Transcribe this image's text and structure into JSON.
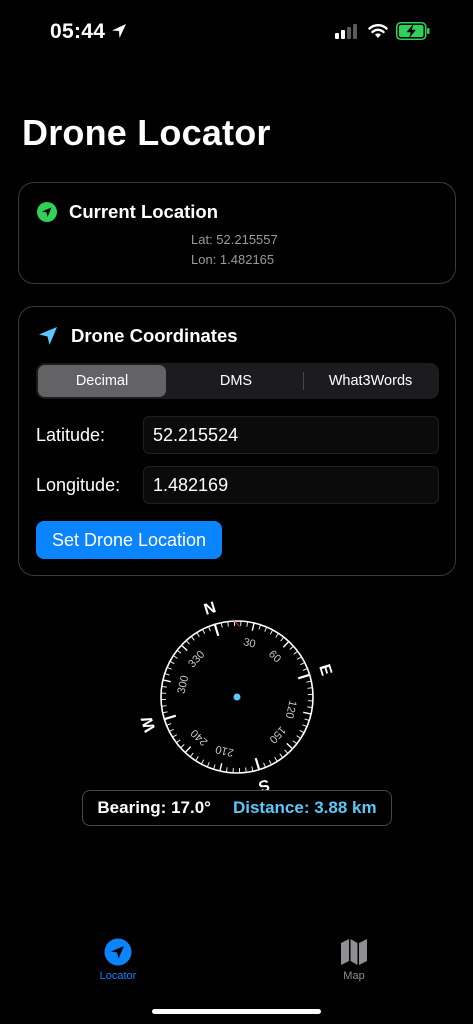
{
  "status_bar": {
    "time": "05:44",
    "battery_state": "charging"
  },
  "page_title": "Drone Locator",
  "current_location": {
    "title": "Current Location",
    "lat_line": "Lat: 52.215557",
    "lon_line": "Lon: 1.482165"
  },
  "drone_coordinates": {
    "title": "Drone Coordinates",
    "segments": [
      "Decimal",
      "DMS",
      "What3Words"
    ],
    "selected_segment": "Decimal",
    "latitude_label": "Latitude:",
    "latitude_value": "52.215524",
    "longitude_label": "Longitude:",
    "longitude_value": "1.482169",
    "set_button": "Set Drone Location"
  },
  "compass": {
    "cardinals": {
      "n": "N",
      "e": "E",
      "s": "S",
      "w": "W"
    },
    "degree_labels": [
      "30",
      "60",
      "120",
      "150",
      "210",
      "240",
      "300",
      "330"
    ],
    "heading_deg": -17,
    "target_bearing_deg": 17
  },
  "readout": {
    "bearing": "Bearing: 17.0°",
    "distance": "Distance: 3.88 km"
  },
  "tab_bar": {
    "tabs": [
      "Locator",
      "Map"
    ],
    "active": "Locator"
  },
  "colors": {
    "accent": "#0a84ff",
    "current_location_icon": "#30d158",
    "drone_icon": "#5ac8fa",
    "distance_text": "#5ac8fa",
    "target_marker": "#ff3b30"
  },
  "icons": {
    "status_location": "location-arrow-icon",
    "current_location": "location-circle-icon",
    "drone": "paper-plane-icon",
    "tab_locator": "location-circle-icon",
    "tab_map": "map-icon"
  }
}
